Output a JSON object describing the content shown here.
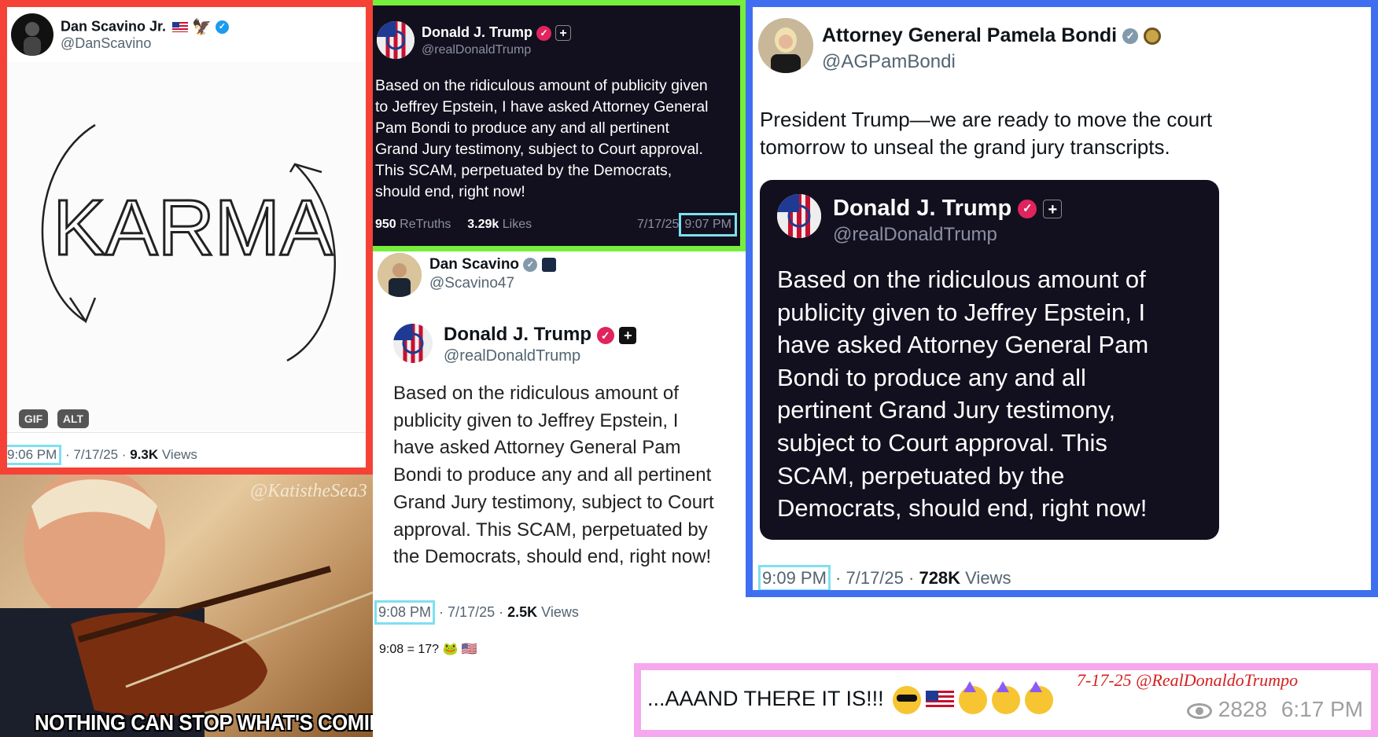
{
  "colors": {
    "frame_red": "#f44336",
    "frame_green": "#76ee3c",
    "frame_blue": "#3f6ff0",
    "frame_pink": "#f6a8ee",
    "highlight": "#7ee0f0",
    "dark_bg": "#12101e"
  },
  "scavino_jr": {
    "name": "Dan Scavino Jr.",
    "handle": "@DanScavino",
    "image_word": "KARMA",
    "gif_label": "GIF",
    "alt_label": "ALT",
    "time": "9:06 PM",
    "date": " · 7/17/25 · ",
    "views_count": "9.3K",
    "views_label": " Views"
  },
  "truth_post": {
    "name": "Donald J. Trump",
    "handle": "@realDonaldTrump",
    "body": "Based on the ridiculous amount of publicity given\nto Jeffrey Epstein, I have asked Attorney General\nPam Bondi to produce any and all pertinent\nGrand Jury testimony, subject to Court approval.\nThis SCAM, perpetuated by the Democrats,\nshould end, right now!",
    "retruths_count": "950",
    "retruths_label": " ReTruths",
    "likes_count": "3.29k",
    "likes_label": " Likes",
    "date": "7/17/25",
    "time": "9:07 PM"
  },
  "scavino47": {
    "name": "Dan Scavino",
    "handle": "@Scavino47",
    "quoted_name": "Donald J. Trump",
    "quoted_handle": "@realDonaldTrump",
    "quoted_body": "Based on the ridiculous amount of\npublicity given to Jeffrey Epstein, I\nhave asked Attorney General Pam\nBondi to produce any and all pertinent\nGrand Jury testimony, subject to Court\napproval. This SCAM, perpetuated by\nthe Democrats, should end, right now!",
    "time": "9:08 PM",
    "date": " · 7/17/25 · ",
    "views_count": "2.5K",
    "views_label": " Views",
    "caption": "9:08 = 17? 🐸 🇺🇸"
  },
  "bondi": {
    "name": "Attorney General Pamela Bondi",
    "handle": "@AGPamBondi",
    "body": "President Trump—we are ready to move the court\ntomorrow to unseal the grand jury transcripts.",
    "quoted_name": "Donald J. Trump",
    "quoted_handle": "@realDonaldTrump",
    "quoted_body": "Based on the ridiculous amount of\npublicity given to Jeffrey Epstein, I\nhave asked Attorney General Pam\nBondi to produce any and all\npertinent Grand Jury testimony,\nsubject to Court approval. This\nSCAM, perpetuated by the\nDemocrats, should end, right now!",
    "time": "9:09 PM",
    "date": " · 7/17/25 · ",
    "views_count": "728K",
    "views_label": " Views"
  },
  "meme": {
    "watermark": "@KatistheSea3",
    "caption": "NOTHING CAN STOP WHAT'S COMING"
  },
  "footer_post": {
    "text": "...AAAND THERE IT IS!!!",
    "emoji_icons": [
      "sunglasses-face-icon",
      "us-flag-icon",
      "partying-face-icon",
      "partying-face-icon",
      "partying-face-icon"
    ],
    "stamp": "7-17-25 @RealDonaldoTrumpo",
    "view_count": "2828",
    "time": "6:17 PM"
  }
}
